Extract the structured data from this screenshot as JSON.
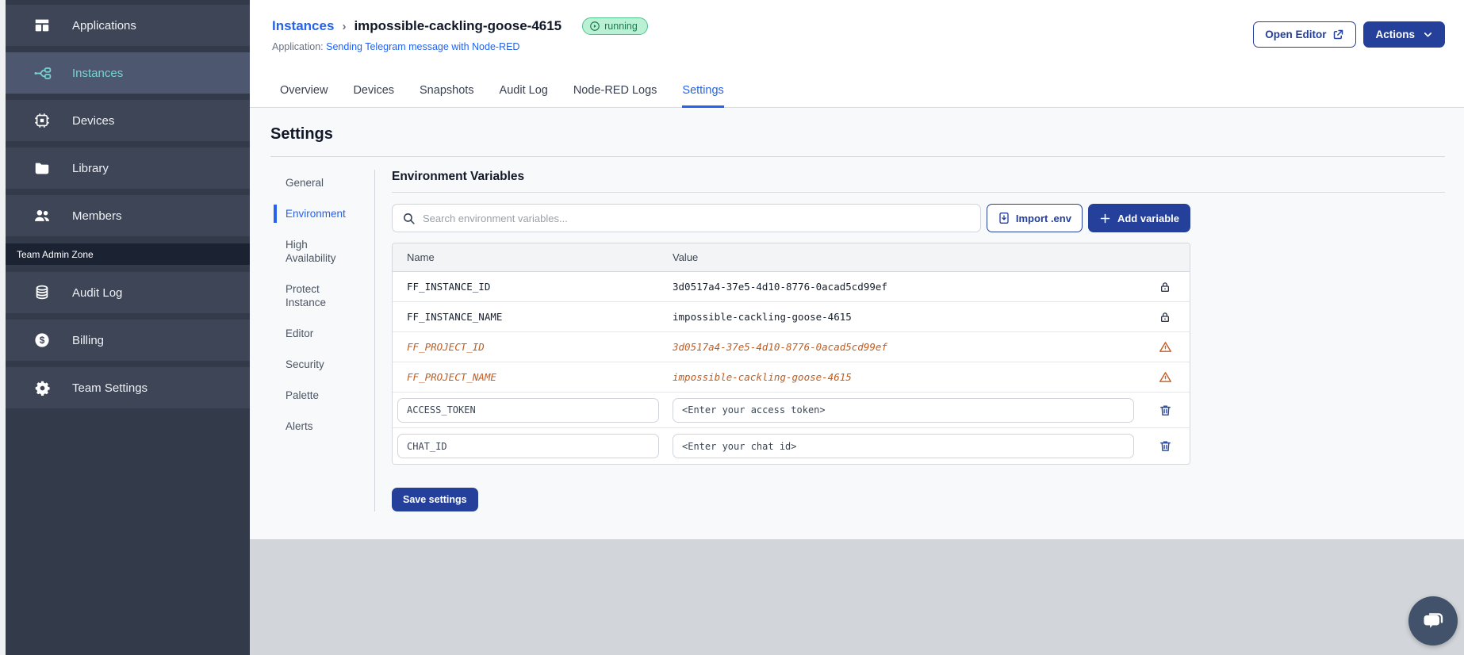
{
  "sidebar": {
    "active_item": "Instances",
    "items": [
      {
        "label": "Applications",
        "icon": "applications-icon"
      },
      {
        "label": "Instances",
        "icon": "instances-icon"
      },
      {
        "label": "Devices",
        "icon": "devices-icon"
      },
      {
        "label": "Library",
        "icon": "library-icon"
      },
      {
        "label": "Members",
        "icon": "members-icon"
      }
    ],
    "section_label": "Team Admin Zone",
    "admin_items": [
      {
        "label": "Audit Log",
        "icon": "database-icon"
      },
      {
        "label": "Billing",
        "icon": "dollar-icon"
      },
      {
        "label": "Team Settings",
        "icon": "gear-icon"
      }
    ]
  },
  "header": {
    "breadcrumb": {
      "parent": "Instances",
      "separator": "›",
      "current": "impossible-cackling-goose-4615"
    },
    "status_badge": "running",
    "application_label": "Application:",
    "application_link": "Sending Telegram message with Node-RED",
    "open_editor_button": "Open Editor",
    "actions_button": "Actions"
  },
  "tabs": {
    "active": "Settings",
    "items": [
      {
        "label": "Overview"
      },
      {
        "label": "Devices"
      },
      {
        "label": "Snapshots"
      },
      {
        "label": "Audit Log"
      },
      {
        "label": "Node-RED Logs"
      },
      {
        "label": "Settings"
      }
    ]
  },
  "settings": {
    "title": "Settings",
    "active_nav": "Environment",
    "nav": [
      {
        "label": "General"
      },
      {
        "label": "Environment"
      },
      {
        "label": "High Availability"
      },
      {
        "label": "Protect Instance"
      },
      {
        "label": "Editor"
      },
      {
        "label": "Security"
      },
      {
        "label": "Palette"
      },
      {
        "label": "Alerts"
      }
    ]
  },
  "environment": {
    "title": "Environment Variables",
    "search_placeholder": "Search environment variables...",
    "import_env_button": "Import .env",
    "add_variable_button": "Add variable",
    "save_settings_button": "Save settings",
    "table": {
      "columns": [
        {
          "label": "Name"
        },
        {
          "label": "Value"
        }
      ],
      "rows": [
        {
          "name": "FF_INSTANCE_ID",
          "value": "3d0517a4-37e5-4d10-8776-0acad5cd99ef",
          "state": "locked",
          "icon": "lock-icon"
        },
        {
          "name": "FF_INSTANCE_NAME",
          "value": "impossible-cackling-goose-4615",
          "state": "locked",
          "icon": "lock-icon"
        },
        {
          "name": "FF_PROJECT_ID",
          "value": "3d0517a4-37e5-4d10-8776-0acad5cd99ef",
          "state": "deprecated",
          "icon": "warning-icon"
        },
        {
          "name": "FF_PROJECT_NAME",
          "value": "impossible-cackling-goose-4615",
          "state": "deprecated",
          "icon": "warning-icon"
        },
        {
          "name": "ACCESS_TOKEN",
          "value": "<Enter your access token>",
          "state": "editable",
          "icon": "trash-icon"
        },
        {
          "name": "CHAT_ID",
          "value": "<Enter your chat id>",
          "state": "editable",
          "icon": "trash-icon"
        }
      ]
    }
  },
  "colors": {
    "accent_blue": "#24409a",
    "link_blue": "#2563eb",
    "sidebar_active_teal": "#76d3cf",
    "status_running_bg": "#baf1d4",
    "status_running_border": "#52c08e",
    "status_running_text": "#1d7a50",
    "deprecated_orange": "#c05d21",
    "sidebar_bg": "#333b4a"
  }
}
